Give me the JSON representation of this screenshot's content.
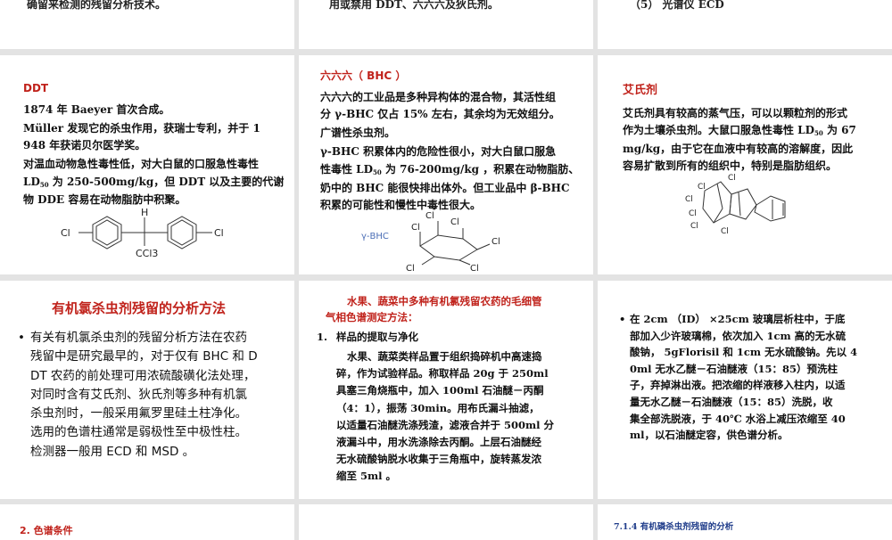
{
  "top_row": {
    "left_cut": "确留来检测的残留分析技术。",
    "mid_cut": "用或禁用 DDT、六六六及狄氏剂。",
    "right_cut": "（5）  光谱仪 ECD"
  },
  "ddt": {
    "title": "DDT",
    "line1": "1874 年 Baeyer 首次合成。",
    "line2": "Müller 发现它的杀虫作用，获瑞士专利，并于 1",
    "line3": "948 年获诺贝尔医学奖。",
    "line4": "对温血动物急性毒性低，对大白鼠的口服急性毒性",
    "line5a": "LD",
    "line5sub": "50",
    "line5b": " 为 250-500mg/kg，但 DDT 以及主要的代谢",
    "line6": "物 DDE 容易在动物脂肪中积聚。",
    "struct": {
      "h": "H",
      "cl_left": "Cl",
      "cl_right": "Cl",
      "ccl3": "CCl3"
    }
  },
  "bhc": {
    "title": "六六六（ BHC ）",
    "line1": "六六六的工业品是多种异构体的混合物，其活性组",
    "line2": "分 γ-BHC 仅占 15% 左右，其余均为无效组分。",
    "line3": "广谱性杀虫剂。",
    "line4": "γ-BHC 积累体内的危险性很小，对大白鼠口服急",
    "line5a": "性毒性 LD",
    "line5sub": "50",
    "line5b": " 为 76-200mg/kg ，积累在动物脂肪、",
    "line6": "奶中的 BHC 能很快排出体外。但工业品中 β-BHC",
    "line7": "积累的可能性和慢性中毒性很大。",
    "struct": {
      "label": "γ-BHC",
      "cl": "Cl"
    }
  },
  "dieldrin": {
    "title": "艾氏剂",
    "line1": "艾氏剂具有较高的蒸气压，可以以颗粒剂的形式",
    "line2a": "作为土壤杀虫剂。大鼠口服急性毒性 LD",
    "line2sub": "50",
    "line2b": " 为 67",
    "line3": "mg/kg，由于它在血液中有较高的溶解度，因此",
    "line4": "容易扩散到所有的组织中，特别是脂肪组织。",
    "struct": {
      "cl": "Cl"
    }
  },
  "method": {
    "title": "有机氯杀虫剂残留的分析方法",
    "line1": "有关有机氯杀虫剂的残留分析方法在农药",
    "line2": "残留中是研究最早的，对于仅有 BHC 和 D",
    "line3": "DT 农药的前处理可用浓硫酸磺化法处理，",
    "line4": "对同时含有艾氏剂、狄氏剂等多种有机氯",
    "line5": "杀虫剂时，一般采用氟罗里硅土柱净化。",
    "line6": "选用的色谱柱通常是弱极性至中极性柱。",
    "line7": "检测器一般用 ECD 和 MSD 。"
  },
  "veg": {
    "title1": "水果、蔬菜中多种有机氯残留农药的毛细管",
    "title2": "气相色谱测定方法：",
    "step_no": "1.",
    "step": "样品的提取与净化",
    "line1": "水果、蔬菜类样品置于组织捣碎机中高速捣",
    "line2": "碎，作为试验样品。称取样品 20g 于 250ml",
    "line3": "具塞三角烧瓶中，加入 100ml 石油醚－丙酮",
    "line4": "（4：1），振荡 30min。用布氏漏斗抽滤，",
    "line5": "以适量石油醚洗涤残渣，滤液合并于 500ml 分",
    "line6": "液漏斗中，用水洗涤除去丙酮。上层石油醚经",
    "line7": "无水硫酸钠脱水收集于三角瓶中，旋转蒸发浓",
    "line8": "缩至 5ml 。"
  },
  "column": {
    "line1": "在 2cm （ID） ×25cm 玻璃层析柱中，于底",
    "line2": "部加入少许玻璃棉，依次加入 1cm 高的无水硫",
    "line3": "酸钠，  5gFlorisil 和 1cm 无水硫酸钠。先以 4",
    "line4": "0ml 无水乙醚－石油醚液（15：85）预洗柱",
    "line5": "子，弃掉淋出液。把浓缩的样液移入柱内，以适",
    "line6": "量无水乙醚－石油醚液（15：85）洗脱，收",
    "line7": "集全部洗脱液，于 40℃ 水浴上减压浓缩至 40",
    "line8": "ml，以石油醚定容，供色谱分析。"
  },
  "bottom_row": {
    "left_title": "2. 色谱条件",
    "right_title": "7.1.4  有机磷杀虫剂残留的分析"
  }
}
